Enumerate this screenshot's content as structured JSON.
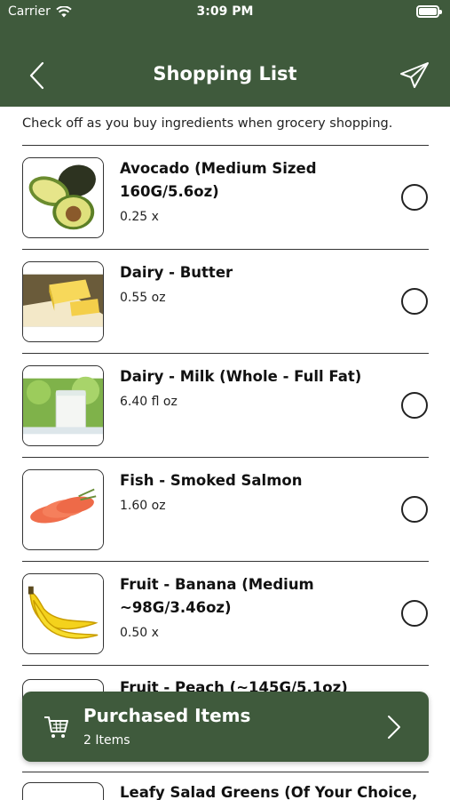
{
  "status_bar": {
    "carrier": "Carrier",
    "time": "3:09 PM"
  },
  "header": {
    "title": "Shopping List",
    "back_icon": "chevron-left-icon",
    "share_icon": "paper-plane-icon"
  },
  "subtitle": "Check off as you buy ingredients when grocery shopping.",
  "items": [
    {
      "name": "Avocado (Medium Sized 160G/5.6oz)",
      "quantity": "0.25 x",
      "checked": false,
      "image": "avocado"
    },
    {
      "name": "Dairy - Butter",
      "quantity": "0.55 oz",
      "checked": false,
      "image": "butter"
    },
    {
      "name": "Dairy - Milk (Whole - Full Fat)",
      "quantity": "6.40 fl oz",
      "checked": false,
      "image": "milk"
    },
    {
      "name": "Fish - Smoked Salmon",
      "quantity": "1.60 oz",
      "checked": false,
      "image": "salmon"
    },
    {
      "name": "Fruit - Banana (Medium ~98G/3.46oz)",
      "quantity": "0.50 x",
      "checked": false,
      "image": "banana"
    },
    {
      "name": "Fruit - Peach (~145G/5.1oz)",
      "image": "peach"
    },
    {
      "name": "Leafy Salad Greens (Of Your Choice,",
      "image": "greens"
    }
  ],
  "purchased": {
    "title": "Purchased Items",
    "count": "2 Items",
    "icon": "cart-icon"
  },
  "colors": {
    "primary": "#3f5a3c",
    "text": "#111111",
    "divider": "#333333"
  }
}
